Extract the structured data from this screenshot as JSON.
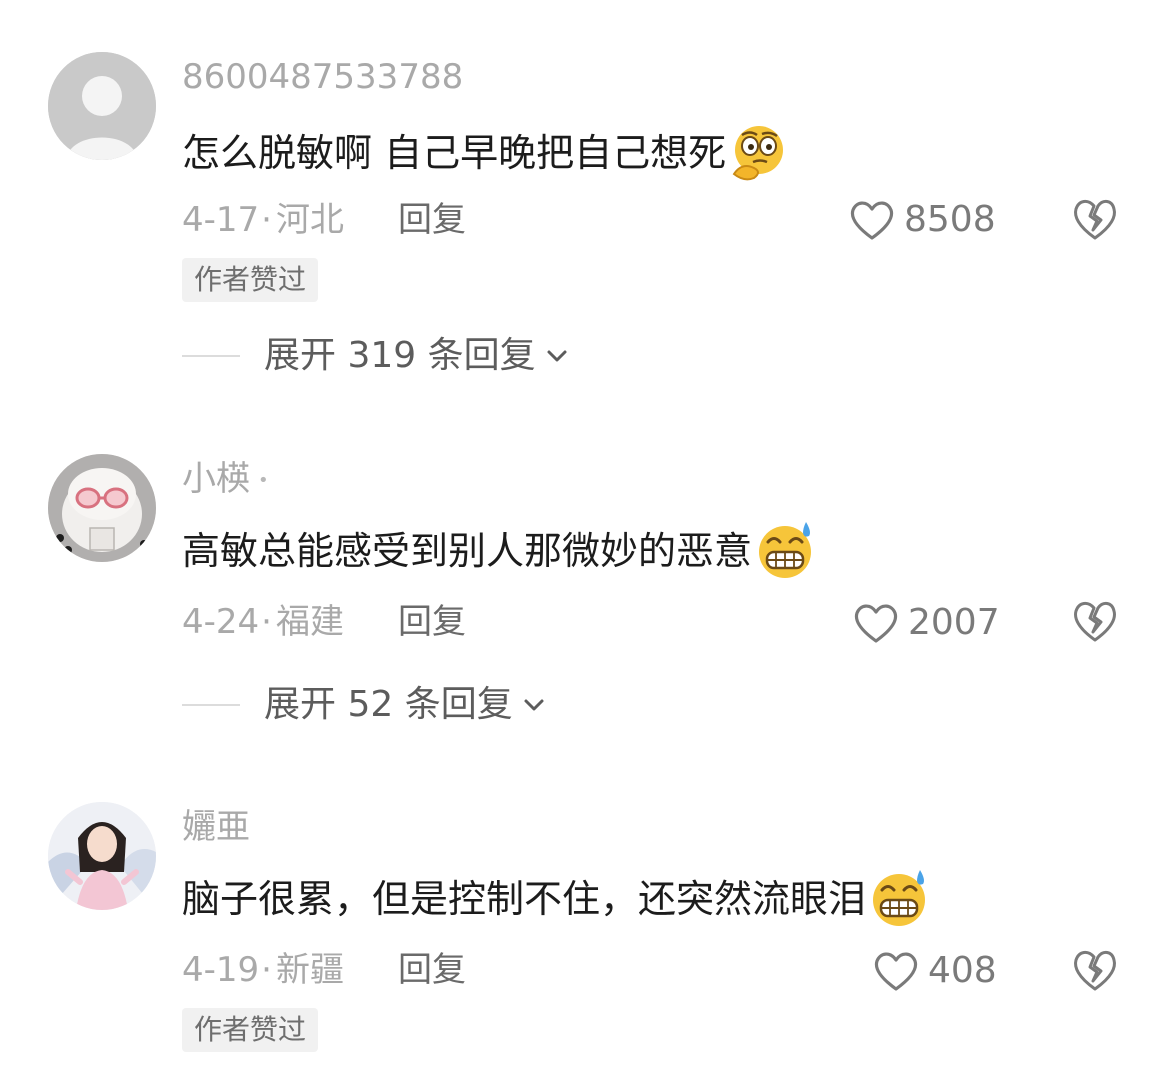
{
  "comments": [
    {
      "username": "8600487533788",
      "text": "怎么脱敏啊 自己早晚把自己想死",
      "emoji_icon": "thinking-face-emoji",
      "date": "4-17",
      "separator": "·",
      "location": "河北",
      "reply_label": "回复",
      "likes": "8508",
      "badge": "作者赞过",
      "expand_label": "展开 319 条回复"
    },
    {
      "username": "小楧",
      "user_marker": "•",
      "text": "高敏总能感受到别人那微妙的恶意",
      "emoji_icon": "grimacing-sweat-emoji",
      "date": "4-24",
      "separator": "·",
      "location": "福建",
      "reply_label": "回复",
      "likes": "2007",
      "expand_label": "展开 52 条回复"
    },
    {
      "username": "孋亜",
      "text": "脑子很累，但是控制不住，还突然流眼泪",
      "emoji_icon": "grimacing-sweat-emoji",
      "date": "4-19",
      "separator": "·",
      "location": "新疆",
      "reply_label": "回复",
      "likes": "408",
      "badge": "作者赞过"
    }
  ],
  "icons": {
    "like": "heart-outline-icon",
    "dislike": "broken-heart-icon",
    "expand": "chevron-down-icon"
  },
  "colors": {
    "username": "#a9a9a9",
    "text": "#1c1c1c",
    "meta": "#a9a9a9",
    "reply": "#6a6a6a",
    "badge_bg": "#f1f1f1",
    "emoji": "#f6c53a"
  }
}
